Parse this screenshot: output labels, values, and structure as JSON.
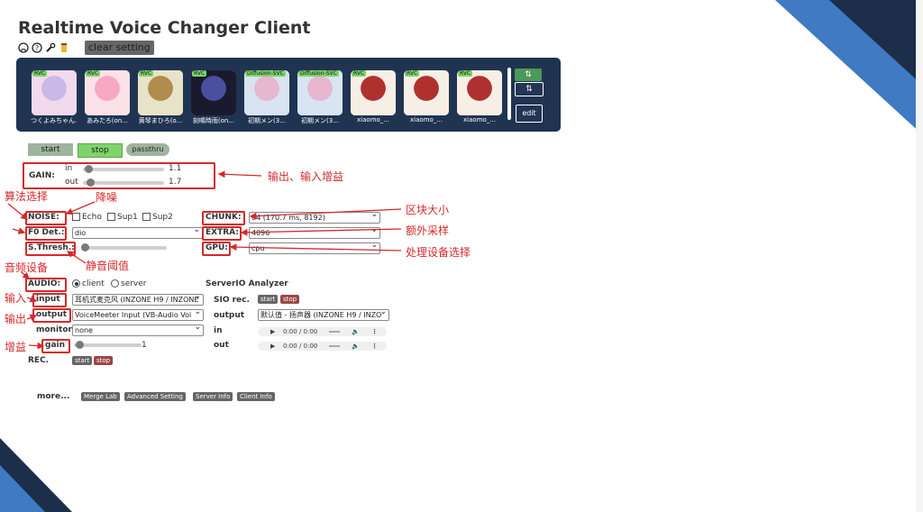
{
  "app": {
    "title": "Realtime Voice Changer Client",
    "version": "- - - -"
  },
  "toolbar": {
    "clear_setting": "clear setting",
    "icons": [
      "github-icon",
      "help-icon",
      "wrench-icon",
      "coffee-icon"
    ]
  },
  "models": [
    {
      "tag": "RVC",
      "name": "つくよみちゃん...",
      "tag_color": "#7fd36b"
    },
    {
      "tag": "RVC",
      "name": "あみたろ(on...",
      "tag_color": "#7fd36b"
    },
    {
      "tag": "RVC",
      "name": "黄琴まひろ(o...",
      "tag_color": "#7fd36b"
    },
    {
      "tag": "RVC",
      "name": "刻鳴時雨(on...",
      "tag_color": "#7fd36b"
    },
    {
      "tag": "Diffusion-SVC",
      "name": "初期メン(3...",
      "tag_color": "#7fd36b"
    },
    {
      "tag": "Diffusion-SVC",
      "name": "初期メン(3...",
      "tag_color": "#7fd36b"
    },
    {
      "tag": "RVC",
      "name": "xiaomo_...",
      "tag_color": "#7fd36b"
    },
    {
      "tag": "RVC",
      "name": "xiaomo_...",
      "tag_color": "#7fd36b"
    },
    {
      "tag": "RVC",
      "name": "xiaomo_...",
      "tag_color": "#7fd36b"
    }
  ],
  "model_side": {
    "sort_up": "⇅",
    "sort_down": "⇅",
    "edit": "edit"
  },
  "controls": {
    "start": "start",
    "stop": "stop",
    "passthru": "passthru"
  },
  "gain": {
    "label": "GAIN:",
    "in_label": "in",
    "in_value": "1.1",
    "out_label": "out",
    "out_value": "1.7"
  },
  "noise": {
    "label": "NOISE:",
    "echo": "Echo",
    "sup1": "Sup1",
    "sup2": "Sup2"
  },
  "f0": {
    "label": "F0 Det.:",
    "value": "dio"
  },
  "sthresh": {
    "label": "S.Thresh.:"
  },
  "chunk": {
    "label": "CHUNK:",
    "value": "64 (170.7 ms, 8192)"
  },
  "extra": {
    "label": "EXTRA:",
    "value": "4096"
  },
  "gpu": {
    "label": "GPU:",
    "value": "cpu"
  },
  "audio": {
    "label": "AUDIO:",
    "client": "client",
    "server": "server",
    "input_label": "input",
    "input_value": "耳机式麦克风 (INZONE H9 / INZONE",
    "output_label": "output",
    "output_value": "VoiceMeeter Input (VB-Audio Voi",
    "monitor_label": "monitor",
    "monitor_value": "none",
    "gain_label": "gain",
    "gain_value": "1",
    "rec_label": "REC.",
    "rec_start": "start",
    "rec_stop": "stop"
  },
  "serverio": {
    "title": "ServerIO Analyzer",
    "sio_rec": "SIO rec.",
    "start": "start",
    "stop": "stop",
    "output_label": "output",
    "output_value": "默认值 - 扬声器 (INZONE H9 / INZO",
    "in_label": "in",
    "out_label": "out",
    "time": "0:00 / 0:00"
  },
  "more": {
    "label": "more...",
    "merge_lab": "Merge Lab",
    "advanced": "Advanced Setting",
    "server_info": "Server Info",
    "client_info": "Client Info"
  },
  "annotations": {
    "gain": "输出、输入增益",
    "algo": "算法选择",
    "noise": "降噪",
    "chunk": "区块大小",
    "extra": "额外采样",
    "gpu": "处理设备选择",
    "sthresh": "静音阈值",
    "audio": "音频设备",
    "input": "输入",
    "output": "输出",
    "gain2": "增益"
  },
  "colors": {
    "panel": "#203452",
    "accent_red": "#d42a2a",
    "start_bg": "#9fb49f",
    "stop_bg": "#7fd36b",
    "corner_blue": "#3f7ac2",
    "corner_dark": "#1c2e4a"
  }
}
